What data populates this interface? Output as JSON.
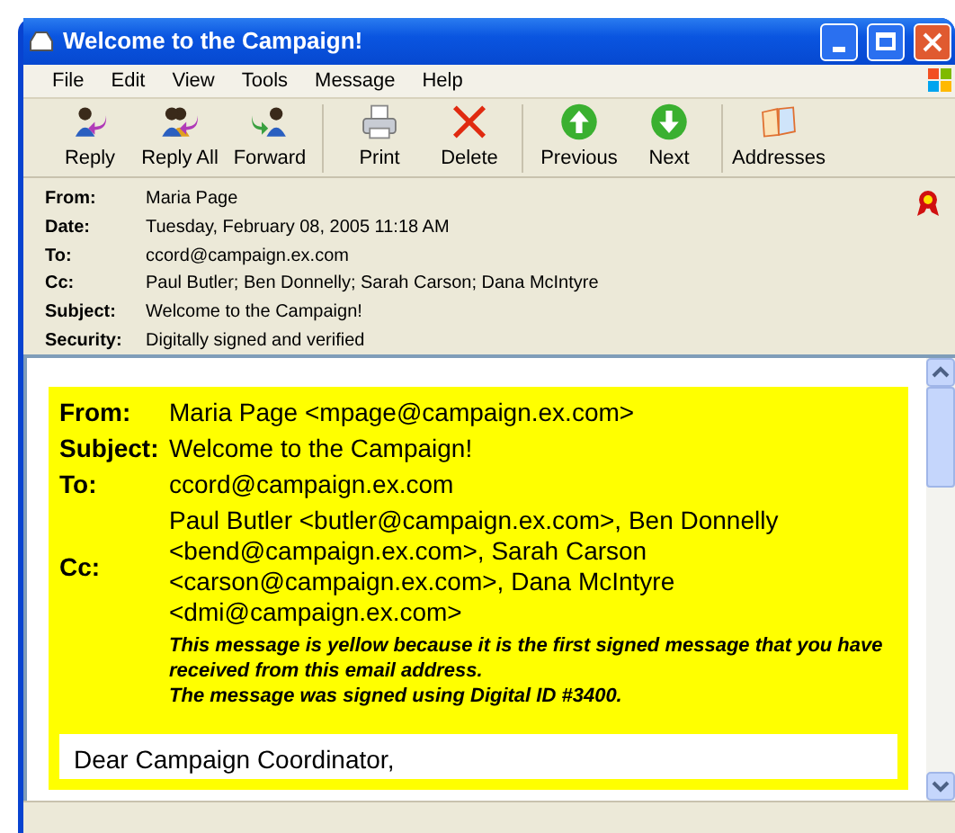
{
  "window": {
    "title": "Welcome to the Campaign!"
  },
  "menu": [
    "File",
    "Edit",
    "View",
    "Tools",
    "Message",
    "Help"
  ],
  "toolbar": [
    [
      {
        "label": "Reply",
        "kind": "reply"
      },
      {
        "label": "Reply All",
        "kind": "reply_all"
      },
      {
        "label": "Forward",
        "kind": "forward"
      }
    ],
    [
      {
        "label": "Print",
        "kind": "print"
      },
      {
        "label": "Delete",
        "kind": "delete"
      }
    ],
    [
      {
        "label": "Previous",
        "kind": "previous"
      },
      {
        "label": "Next",
        "kind": "next"
      }
    ],
    [
      {
        "label": "Addresses",
        "kind": "addresses"
      }
    ]
  ],
  "header": [
    {
      "label": "From:",
      "value": "Maria Page"
    },
    {
      "label": "Date:",
      "value": "Tuesday, February 08, 2005 11:18 AM"
    },
    {
      "label": "To:",
      "value": "ccord@campaign.ex.com"
    },
    {
      "label": "Cc:",
      "value": "Paul Butler; Ben Donnelly; Sarah Carson; Dana McIntyre"
    },
    {
      "label": "Subject:",
      "value": "Welcome to the Campaign!"
    },
    {
      "label": "Security:",
      "value": "Digitally signed and verified"
    }
  ],
  "security_banner": {
    "fields": [
      {
        "label": "From:",
        "value": "Maria Page <mpage@campaign.ex.com>"
      },
      {
        "label": "Subject:",
        "value": "Welcome to the Campaign!"
      },
      {
        "label": "To:",
        "value": "ccord@campaign.ex.com"
      },
      {
        "label": "Cc:",
        "value": "Paul Butler <butler@campaign.ex.com>, Ben Donnelly <bend@campaign.ex.com>, Sarah Carson <carson@campaign.ex.com>, Dana McIntyre <dmi@campaign.ex.com>"
      }
    ],
    "notes": [
      "This message is yellow because it is the first signed message that you have received from this email address.",
      "The message was signed using Digital ID #3400."
    ]
  },
  "body": [
    "Dear Campaign Coordinator,"
  ]
}
